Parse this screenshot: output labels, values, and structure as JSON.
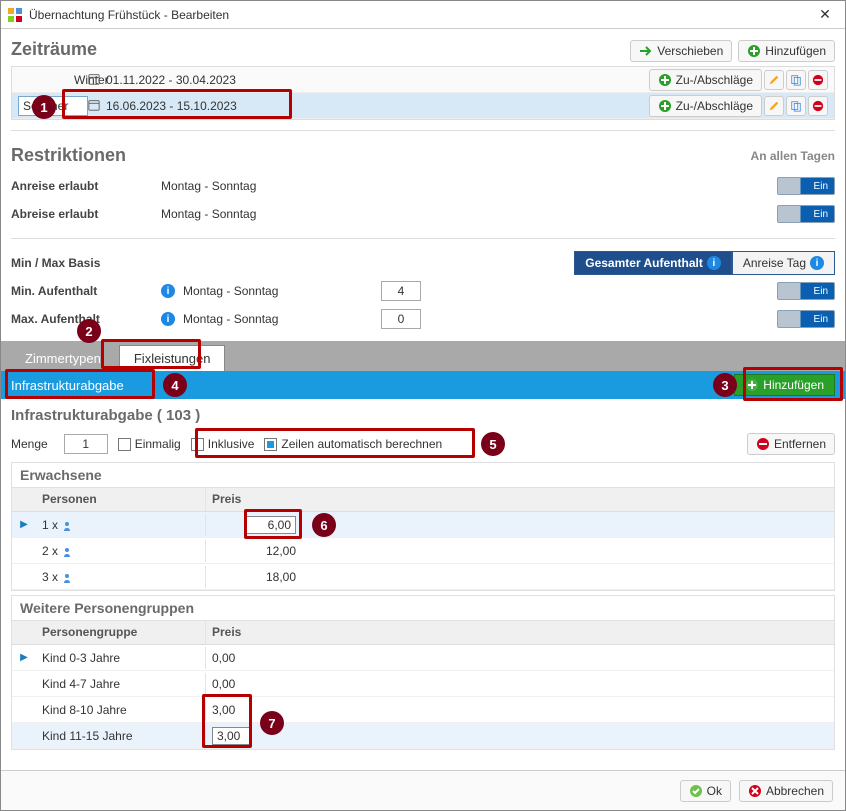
{
  "window": {
    "title": "Übernachtung Frühstück - Bearbeiten"
  },
  "zeitraeume": {
    "heading": "Zeiträume",
    "verschieben": "Verschieben",
    "hinzufuegen": "Hinzufügen",
    "zuabschlaege": "Zu-/Abschläge",
    "rows": [
      {
        "name": "Winter",
        "dates": "01.11.2022 - 30.04.2023"
      },
      {
        "name": "Sommer",
        "dates": "16.06.2023 - 15.10.2023"
      }
    ]
  },
  "restriktionen": {
    "heading": "Restriktionen",
    "all_days": "An allen Tagen",
    "anreise_label": "Anreise erlaubt",
    "anreise_value": "Montag - Sonntag",
    "abreise_label": "Abreise erlaubt",
    "abreise_value": "Montag - Sonntag",
    "toggle_on": "Ein"
  },
  "minmax": {
    "basis_label": "Min / Max Basis",
    "seg_gesamt": "Gesamter Aufenthalt",
    "seg_anreise": "Anreise Tag",
    "min_label": "Min. Aufenthalt",
    "min_days": "Montag - Sonntag",
    "min_value": "4",
    "max_label": "Max. Aufenthalt",
    "max_days": "Montag - Sonntag",
    "max_value": "0",
    "toggle_on": "Ein"
  },
  "tabs": {
    "zimmertypen": "Zimmertypen",
    "fixleistungen": "Fixleistungen"
  },
  "fix": {
    "selected_name": "Infrastrukturabgabe",
    "hinzufuegen": "Hinzufügen",
    "detail_title": "Infrastrukturabgabe  ( 103 )",
    "menge_label": "Menge",
    "menge_value": "1",
    "einmalig": "Einmalig",
    "inklusive": "Inklusive",
    "auto": "Zeilen automatisch berechnen",
    "entfernen": "Entfernen"
  },
  "erwachsene": {
    "heading": "Erwachsene",
    "col_personen": "Personen",
    "col_preis": "Preis",
    "rows": [
      {
        "label": "1 x",
        "preis": "6,00",
        "editable": true
      },
      {
        "label": "2 x",
        "preis": "12,00"
      },
      {
        "label": "3 x",
        "preis": "18,00"
      }
    ]
  },
  "weitere": {
    "heading": "Weitere Personengruppen",
    "col_group": "Personengruppe",
    "col_preis": "Preis",
    "rows": [
      {
        "label": "Kind 0-3 Jahre",
        "preis": "0,00"
      },
      {
        "label": "Kind 4-7 Jahre",
        "preis": "0,00"
      },
      {
        "label": "Kind 8-10 Jahre",
        "preis": "3,00"
      },
      {
        "label": "Kind 11-15 Jahre",
        "preis": "3,00",
        "editable": true
      }
    ]
  },
  "footer": {
    "ok": "Ok",
    "cancel": "Abbrechen"
  },
  "callouts": [
    "1",
    "2",
    "3",
    "4",
    "5",
    "6",
    "7"
  ]
}
